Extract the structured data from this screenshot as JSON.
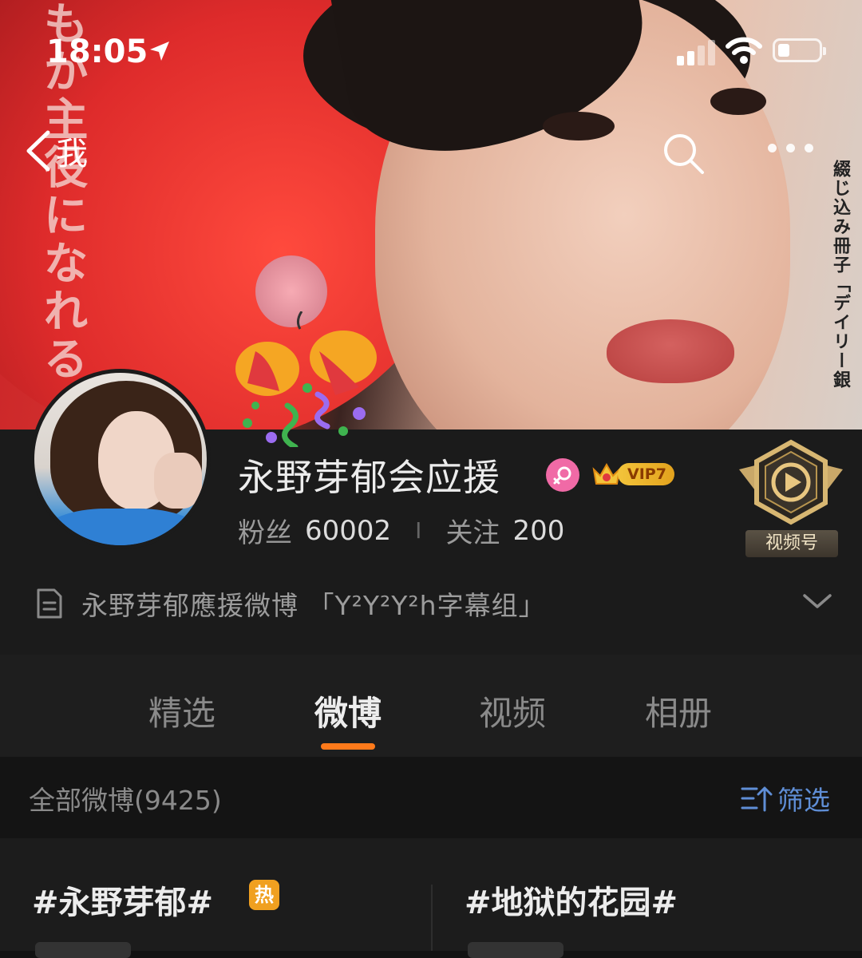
{
  "status_bar": {
    "time": "18:05"
  },
  "nav": {
    "back_label": "我"
  },
  "profile": {
    "username": "永野芽郁会应援",
    "vip_label": "VIP7",
    "fans_label": "粉丝",
    "fans_count": "60002",
    "stats_separator": "I",
    "following_label": "关注",
    "following_count": "200",
    "video_badge_label": "视频号",
    "description": "永野芽郁應援微博 「Y²Y²Y²h字幕组」"
  },
  "tabs": [
    {
      "label": "精选",
      "active": false
    },
    {
      "label": "微博",
      "active": true
    },
    {
      "label": "视频",
      "active": false
    },
    {
      "label": "相册",
      "active": false
    }
  ],
  "filter": {
    "all_posts_label": "全部微博(9425)",
    "filter_label": "筛选"
  },
  "topics": [
    {
      "label": "#永野芽郁#",
      "badge": "热"
    },
    {
      "label": "#地狱的花园#"
    }
  ],
  "colors": {
    "accent": "#ff7a1a",
    "link": "#5f8ed6",
    "vip": "#f3c43b",
    "gender": "#f06aa6"
  }
}
